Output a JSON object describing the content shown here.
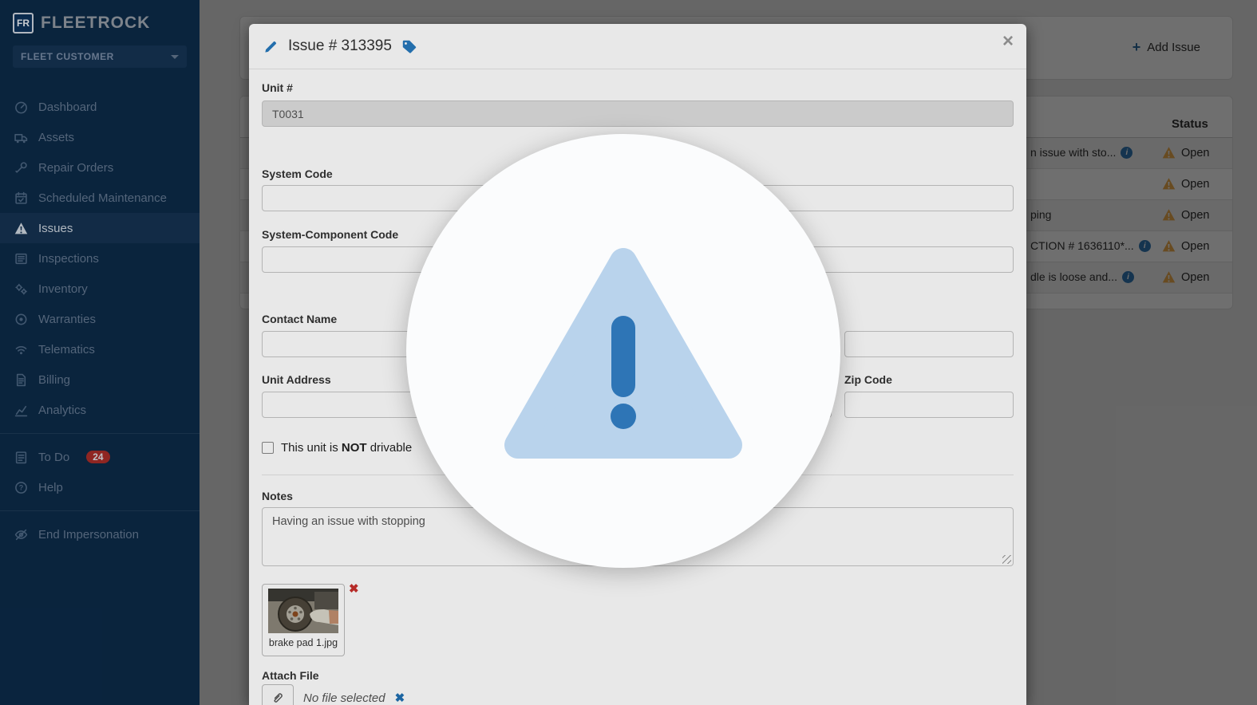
{
  "colors": {
    "sidebar_bg": "#0b2844",
    "accent_blue": "#2779bd",
    "warning_orange": "#f0ad4e",
    "badge_red": "#9e2a26",
    "alert_triangle_light": "#b9d3ec",
    "alert_exclamation_blue": "#2e75b6"
  },
  "sidebar": {
    "brand": "FLEETROCK",
    "brand_badge": "FR",
    "customer_selector": "FLEET CUSTOMER",
    "items": [
      {
        "label": "Dashboard",
        "icon": "dashboard"
      },
      {
        "label": "Assets",
        "icon": "truck"
      },
      {
        "label": "Repair Orders",
        "icon": "wrench"
      },
      {
        "label": "Scheduled Maintenance",
        "icon": "calendar"
      },
      {
        "label": "Issues",
        "icon": "warning",
        "active": true
      },
      {
        "label": "Inspections",
        "icon": "inspections"
      },
      {
        "label": "Inventory",
        "icon": "cogs"
      },
      {
        "label": "Warranties",
        "icon": "badge"
      },
      {
        "label": "Telematics",
        "icon": "wifi"
      },
      {
        "label": "Billing",
        "icon": "file"
      },
      {
        "label": "Analytics",
        "icon": "chart"
      },
      {
        "label": "To Do",
        "icon": "tasks",
        "badge": "24",
        "divider_before": true
      },
      {
        "label": "Help",
        "icon": "help"
      },
      {
        "label": "End Impersonation",
        "icon": "eye-off",
        "divider_before": true
      }
    ]
  },
  "main": {
    "add_issue_label": "Add Issue",
    "plus_glyph": "+",
    "table": {
      "status_header": "Status",
      "info_glyph": "i",
      "rows": [
        {
          "fragment": "n issue with sto...",
          "has_info": true,
          "status": "Open"
        },
        {
          "fragment": "",
          "has_info": false,
          "status": "Open"
        },
        {
          "fragment": "ping",
          "has_info": false,
          "status": "Open"
        },
        {
          "fragment": "CTION # 1636110*...",
          "has_info": true,
          "status": "Open"
        },
        {
          "fragment": "dle is loose and...",
          "has_info": true,
          "status": "Open"
        }
      ]
    }
  },
  "modal": {
    "title": "Issue # 313395",
    "close_glyph": "×",
    "unit_label": "Unit #",
    "unit_value": "T0031",
    "system_code_label": "System Code",
    "system_component_label": "System-Component Code",
    "contact_name_label": "Contact Name",
    "unit_address_label": "Unit Address",
    "zip_code_label": "Zip Code",
    "not_drivable_pre": "This unit is ",
    "not_drivable_bold": "NOT",
    "not_drivable_post": " drivable",
    "notes_label": "Notes",
    "notes_value": "Having an issue with stopping",
    "attachment_name": "brake pad 1.jpg",
    "remove_glyph": "✖",
    "attach_file_label": "Attach File",
    "no_file_text": "No file selected",
    "clear_glyph": "✖"
  }
}
